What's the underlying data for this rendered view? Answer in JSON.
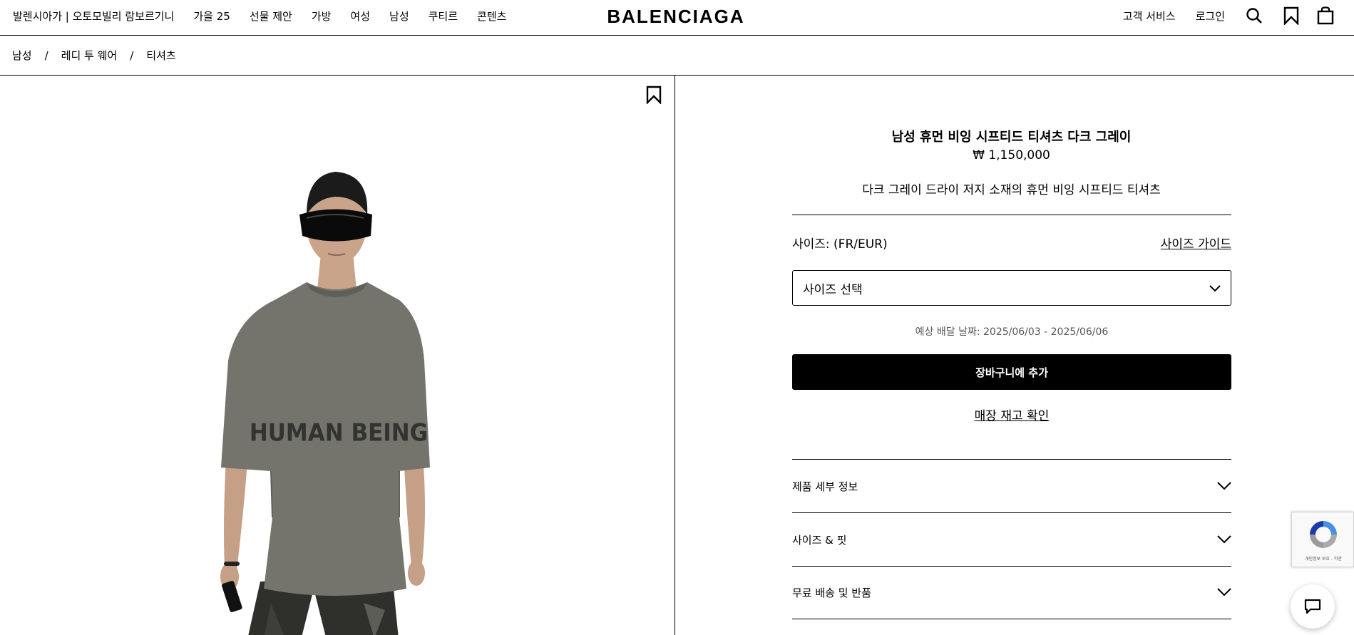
{
  "header": {
    "nav_left": [
      "발렌시아가 | 오토모빌리 람보르기니",
      "가을 25",
      "선물 제안",
      "가방",
      "여성",
      "남성",
      "쿠티르",
      "콘텐츠"
    ],
    "logo": "BALENCIAGA",
    "nav_right": [
      "고객 서비스",
      "로그인"
    ]
  },
  "breadcrumb": [
    "남성",
    "레디 투 웨어",
    "티셔츠"
  ],
  "breadcrumb_sep": "/",
  "product": {
    "title": "남성 휴먼 비잉 시프티드 티셔츠 다크 그레이",
    "price": "₩ 1,150,000",
    "description": "다크 그레이 드라이 저지 소재의 휴먼 비잉 시프티드 티셔츠",
    "shirt_print": "HUMAN BEING"
  },
  "size": {
    "label": "사이즈: (FR/EUR)",
    "guide_label": "사이즈 가이드",
    "select_value": "사이즈 선택"
  },
  "delivery_text": "예상 배달 날짜: 2025/06/03 - 2025/06/06",
  "add_to_cart": "장바구니에 추가",
  "store_check": "매장 재고 확인",
  "accordion": [
    "제품 세부 정보",
    "사이즈 & 핏",
    "무료 배송 및 반품"
  ],
  "recaptcha_text": "개인정보 보호 - 약관",
  "icons": {
    "search": "search-icon",
    "bookmark": "bookmark-icon",
    "cart": "shopping-bag-icon",
    "chevron": "chevron-down-icon",
    "chat": "chat-icon"
  }
}
